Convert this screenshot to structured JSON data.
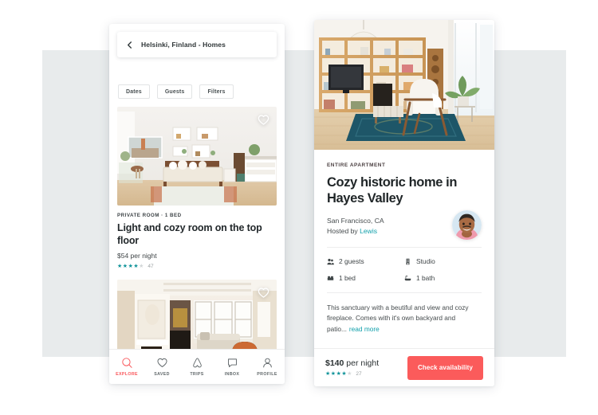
{
  "colors": {
    "background_band": "#e8ebec",
    "accent_coral": "#fb5b5b",
    "accent_teal": "#12a0ab",
    "star_teal": "#11949a",
    "text_dark": "#22282b"
  },
  "search_phone": {
    "back_icon": "chevron-left-icon",
    "search_value": "Helsinki, Finland - Homes",
    "filters": [
      {
        "label": "Dates"
      },
      {
        "label": "Guests"
      },
      {
        "label": "Filters"
      }
    ],
    "listings": [
      {
        "photo_alt": "bright bedroom with wooden bed and wall shelves",
        "favorite_icon": "heart-icon",
        "kicker": "PRIVATE ROOM · 1 BED",
        "title": "Light and cozy room on the top floor",
        "price": "$54 per night",
        "stars_filled": 4,
        "stars_total": 5,
        "review_count": "47"
      },
      {
        "photo_alt": "victorian living room with bay windows and orange leather armchair",
        "favorite_icon": "heart-icon",
        "kicker": "",
        "title": "",
        "price": "",
        "stars_filled": 0,
        "stars_total": 5,
        "review_count": ""
      }
    ],
    "tabs": [
      {
        "label": "EXPLORE",
        "icon": "search-icon",
        "active": true
      },
      {
        "label": "SAVED",
        "icon": "heart-icon",
        "active": false
      },
      {
        "label": "TRIPS",
        "icon": "airbnb-belo-icon",
        "active": false
      },
      {
        "label": "INBOX",
        "icon": "speech-bubble-icon",
        "active": false
      },
      {
        "label": "PROFILE",
        "icon": "person-icon",
        "active": false
      }
    ]
  },
  "detail_phone": {
    "hero_alt": "living room with wooden shelving unit, TV, white armchair and teal rug",
    "kicker": "ENTIRE APARTMENT",
    "title": "Cozy historic home in Hayes Valley",
    "location": "San Francisco, CA",
    "hosted_by_prefix": "Hosted by ",
    "host_name": "Lewis",
    "avatar_alt": "smiling man in pink shirt",
    "amenities": [
      {
        "label": "2 guests",
        "icon": "guests-icon"
      },
      {
        "label": "Studio",
        "icon": "building-icon"
      },
      {
        "label": "1 bed",
        "icon": "bed-icon"
      },
      {
        "label": "1 bath",
        "icon": "bath-icon"
      }
    ],
    "description": "This sanctuary with a beutiful and view and cozy fireplace. Comes with it's own backyard and patio...",
    "read_more": "read more",
    "price_amount": "$140",
    "price_unit": " per night",
    "stars_filled": 4,
    "stars_total": 5,
    "review_count": "27",
    "cta_label": "Check availability"
  }
}
